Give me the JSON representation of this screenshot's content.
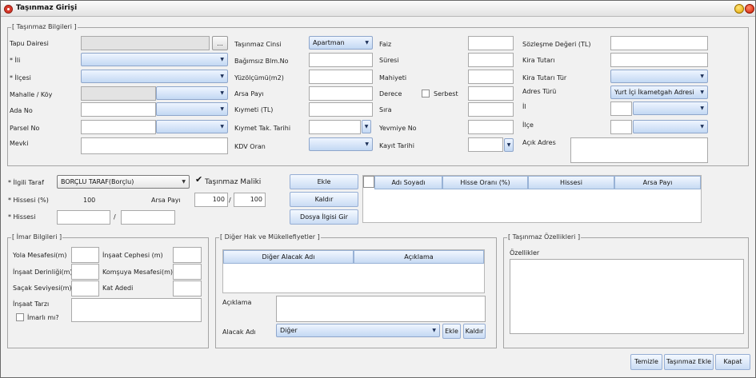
{
  "window": {
    "title": "Taşınmaz Girişi"
  },
  "tasinmaz": {
    "group_title": "[ Taşınmaz Bilgileri ]",
    "tapu_dairesi": {
      "label": "Tapu Dairesi",
      "button": "..."
    },
    "il": {
      "label": "* İli"
    },
    "ilce": {
      "label": "* İlçesi"
    },
    "mahalle": {
      "label": "Mahalle / Köy"
    },
    "ada": {
      "label": "Ada No"
    },
    "parsel": {
      "label": "Parsel No"
    },
    "mevki": {
      "label": "Mevki"
    },
    "cinsi": {
      "label": "Taşınmaz Cinsi",
      "value": "Apartman"
    },
    "bagimsiz": {
      "label": "Bağımsız Blm.No"
    },
    "yuzolcum": {
      "label": "Yüzölçümü(m2)"
    },
    "arsa_payi": {
      "label": "Arsa Payı"
    },
    "kiymeti": {
      "label": "Kıymeti (TL)"
    },
    "kiymet_tarihi": {
      "label": "Kıymet Tak. Tarihi"
    },
    "kdv": {
      "label": "KDV Oran"
    },
    "faiz": {
      "label": "Faiz"
    },
    "suresi": {
      "label": "Süresi"
    },
    "mahiyeti": {
      "label": "Mahiyeti"
    },
    "derece": {
      "label": "Derece",
      "serbest": "Serbest"
    },
    "sira": {
      "label": "Sıra"
    },
    "yevmiye": {
      "label": "Yevmiye No"
    },
    "kayit_tarihi": {
      "label": "Kayıt Tarihi"
    },
    "sozlesme": {
      "label": "Sözleşme Değeri (TL)"
    },
    "kira_tutari": {
      "label": "Kira Tutarı"
    },
    "kira_tur": {
      "label": "Kira Tutarı Tür"
    },
    "adres_turu": {
      "label": "Adres Türü",
      "value": "Yurt İçi İkametgah Adresi"
    },
    "adr_il": {
      "label": "İl"
    },
    "adr_ilce": {
      "label": "İlçe"
    },
    "acik_adres": {
      "label": "Açık Adres"
    }
  },
  "taraf": {
    "ilgili_taraf": {
      "label": "* İlgili Taraf",
      "value": "BORÇLU TARAF(Borçlu)"
    },
    "malik": {
      "label": "Taşınmaz Maliki",
      "checked": true
    },
    "hissesi_yuzde": {
      "label": "* Hissesi (%)",
      "value": "100"
    },
    "arsa_payi": {
      "label": "Arsa Payı",
      "value1": "100",
      "sep": "/",
      "value2": "100"
    },
    "hissesi": {
      "label": "* Hissesi",
      "sep": "/"
    },
    "buttons": {
      "ekle": "Ekle",
      "kaldir": "Kaldır",
      "dosya": "Dosya İlgisi Gir"
    },
    "columns": [
      "Adı Soyadı",
      "Hisse Oranı (%)",
      "Hissesi",
      "Arsa Payı"
    ]
  },
  "imar": {
    "group_title": "[ İmar Bilgileri ]",
    "yola_mesafe": "Yola Mesafesi(m)",
    "insaat_cephesi": "İnşaat Cephesi (m)",
    "insaat_derinligi": "İnşaat Derinliği(m)",
    "komsuya_mesafe": "Komşuya Mesafesi(m)",
    "sacak_seviyesi": "Saçak Seviyesi(m)",
    "kat_adedi": "Kat Adedi",
    "insaat_tarzi": "İnşaat Tarzı",
    "imarli": "İmarlı mı?"
  },
  "diger": {
    "group_title": "[ Diğer Hak ve Mükellefiyetler ]",
    "columns": [
      "Diğer Alacak Adı",
      "Açıklama"
    ],
    "aciklama": "Açıklama",
    "alacak_adi": {
      "label": "Alacak Adı",
      "value": "Diğer"
    },
    "ekle": "Ekle",
    "kaldir": "Kaldır"
  },
  "ozellik": {
    "group_title": "[ Taşınmaz Özellikleri ]",
    "label": "Özellikler"
  },
  "footer": {
    "temizle": "Temizle",
    "ekle": "Taşınmaz Ekle",
    "kapat": "Kapat"
  }
}
